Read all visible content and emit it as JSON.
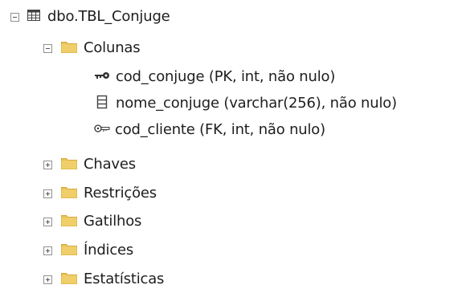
{
  "tree": {
    "table": {
      "label": "dbo.TBL_Conjuge",
      "expanded": true,
      "icon": "table-icon"
    },
    "columns_folder": {
      "label": "Colunas",
      "expanded": true,
      "icon": "folder-icon",
      "items": [
        {
          "label": "cod_conjuge (PK, int, não nulo)",
          "icon": "primary-key-icon"
        },
        {
          "label": "nome_conjuge (varchar(256), não nulo)",
          "icon": "column-icon"
        },
        {
          "label": "cod_cliente (FK, int, não nulo)",
          "icon": "foreign-key-icon"
        }
      ]
    },
    "folders": [
      {
        "label": "Chaves",
        "expanded": false,
        "icon": "folder-icon"
      },
      {
        "label": "Restrições",
        "expanded": false,
        "icon": "folder-icon"
      },
      {
        "label": "Gatilhos",
        "expanded": false,
        "icon": "folder-icon"
      },
      {
        "label": "Índices",
        "expanded": false,
        "icon": "folder-icon"
      },
      {
        "label": "Estatísticas",
        "expanded": false,
        "icon": "folder-icon"
      }
    ]
  },
  "colors": {
    "folder": "#e8c25a",
    "folder_dark": "#d4a93a",
    "text": "#1e1e1e",
    "expander_border": "#919191"
  }
}
